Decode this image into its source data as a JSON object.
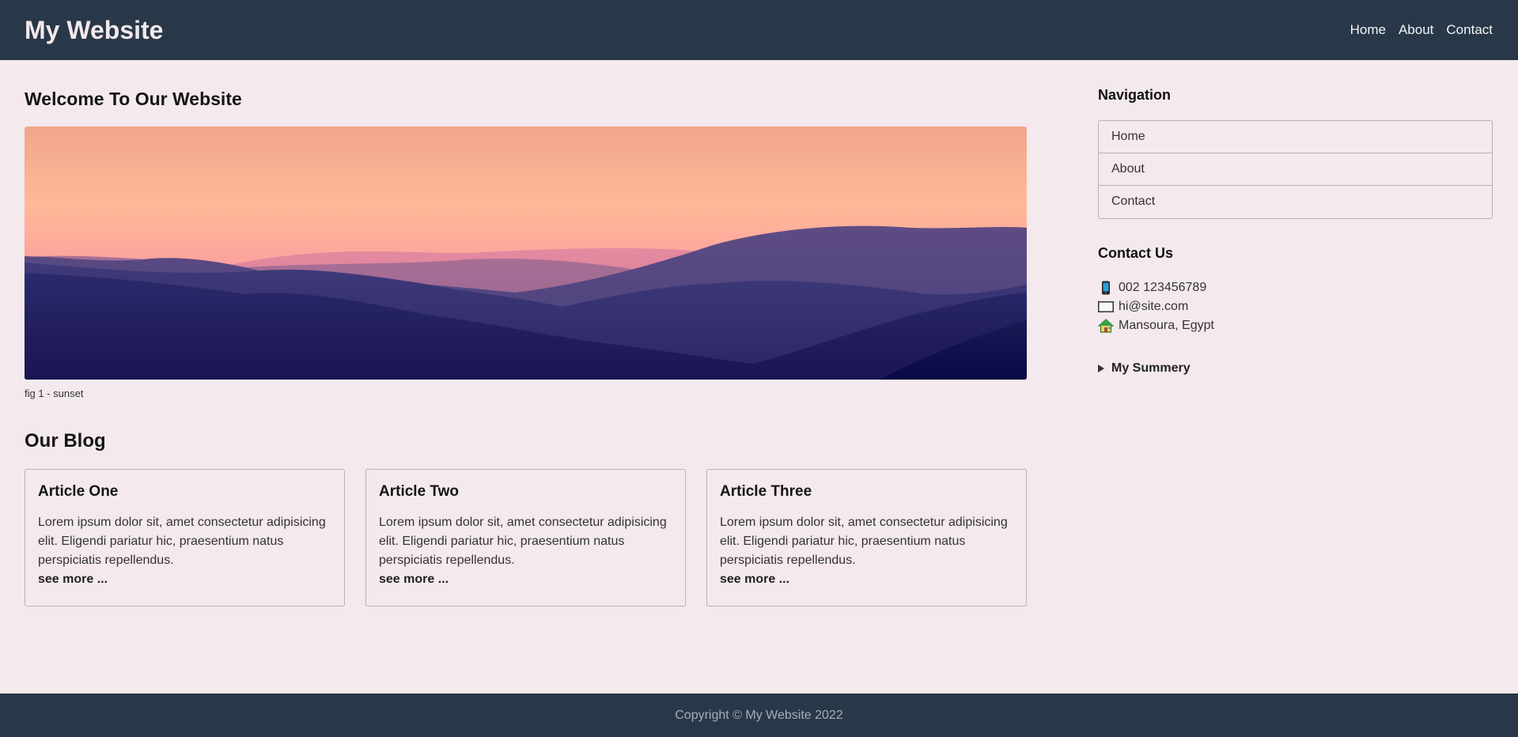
{
  "header": {
    "brand": "My Website",
    "nav": [
      "Home",
      "About",
      "Contact"
    ]
  },
  "main": {
    "title": "Welcome To Our Website",
    "figure_caption": "fig 1 - sunset",
    "blog_title": "Our Blog",
    "articles": [
      {
        "title": "Article One",
        "body": "Lorem ipsum dolor sit, amet consectetur adipisicing elit. Eligendi pariatur hic, praesentium natus perspiciatis repellendus.",
        "more": "see more ..."
      },
      {
        "title": "Article Two",
        "body": "Lorem ipsum dolor sit, amet consectetur adipisicing elit. Eligendi pariatur hic, praesentium natus perspiciatis repellendus.",
        "more": "see more ..."
      },
      {
        "title": "Article Three",
        "body": "Lorem ipsum dolor sit, amet consectetur adipisicing elit. Eligendi pariatur hic, praesentium natus perspiciatis repellendus.",
        "more": "see more ..."
      }
    ]
  },
  "sidebar": {
    "nav_title": "Navigation",
    "nav": [
      "Home",
      "About",
      "Contact"
    ],
    "contact_title": "Contact Us",
    "contacts": [
      {
        "icon": "phone-icon",
        "text": "002 123456789"
      },
      {
        "icon": "envelope-icon",
        "text": "hi@site.com"
      },
      {
        "icon": "house-icon",
        "text": "Mansoura, Egypt"
      }
    ],
    "summary": "My Summery"
  },
  "footer": {
    "copyright": "Copyright © My Website 2022"
  },
  "colors": {
    "header_bg": "#283849",
    "page_bg": "#f4e9ec"
  }
}
